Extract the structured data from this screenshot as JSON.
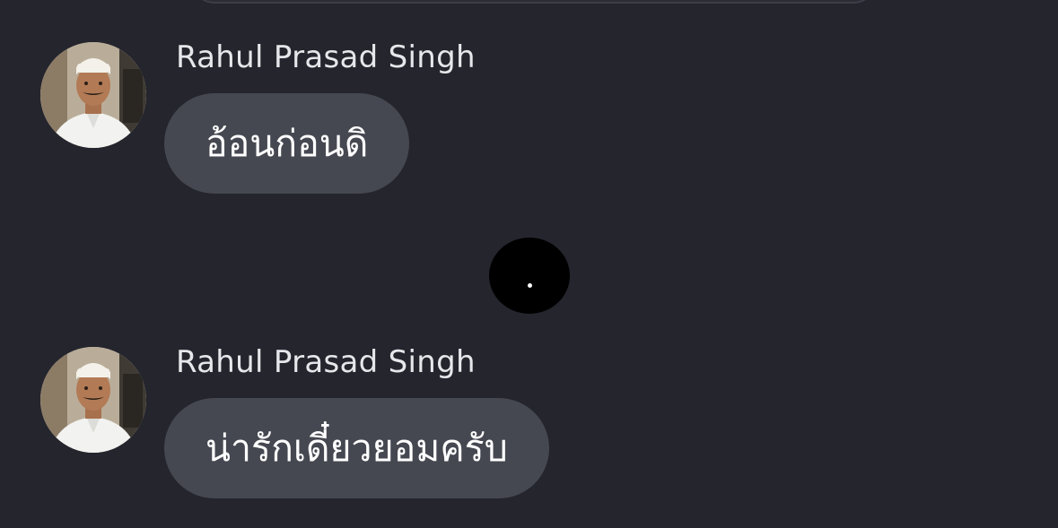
{
  "messages": [
    {
      "sender": "Rahul Prasad Singh",
      "text": "อ้อนก่อนดิ"
    },
    {
      "sender": "Rahul Prasad Singh",
      "text": "น่ารักเดี๋ยวยอมครับ"
    }
  ],
  "colors": {
    "background": "#24252d",
    "bubble": "#464851",
    "sender_name": "#e6e7ea",
    "message_text": "#ffffff",
    "indicator": "#000000"
  },
  "icons": {
    "avatar": "profile-photo",
    "indicator": "typing-indicator"
  }
}
